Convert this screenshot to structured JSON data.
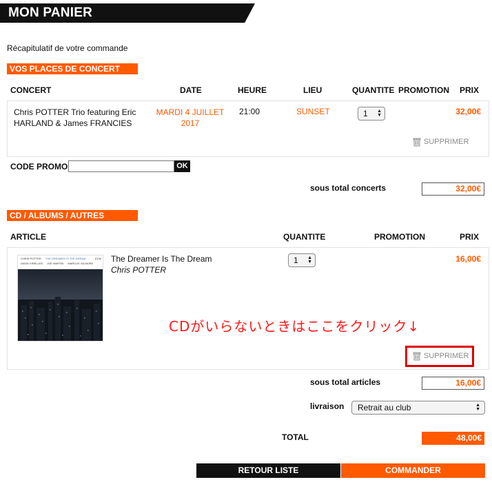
{
  "header": {
    "title": "MON PANIER"
  },
  "recap": "Récapitulatif de votre commande",
  "concerts": {
    "section_title": "VOS PLACES DE CONCERT",
    "columns": {
      "concert": "CONCERT",
      "date": "DATE",
      "heure": "HEURE",
      "lieu": "LIEU",
      "quantite": "QUANTITE",
      "promotion": "PROMOTION",
      "prix": "PRIX"
    },
    "item": {
      "title_line1": "Chris POTTER Trio featuring Eric",
      "title_line2": "HARLAND & James FRANCIES",
      "date_line1": "MARDI 4 JUILLET",
      "date_line2": "2017",
      "heure": "21:00",
      "lieu": "SUNSET",
      "quantite": "1",
      "prix": "32,00€",
      "delete_label": "SUPPRIMER"
    },
    "promo_label": "CODE PROMO",
    "promo_value": "",
    "promo_ok": "OK",
    "subtotal_label": "sous total concerts",
    "subtotal_value": "32,00€"
  },
  "articles": {
    "section_title": "CD / ALBUMS / AUTRES",
    "columns": {
      "article": "ARTICLE",
      "quantite": "QUANTITE",
      "promotion": "PROMOTION",
      "prix": "PRIX"
    },
    "item": {
      "title": "The Dreamer Is The Dream",
      "artist": "Chris POTTER",
      "quantite": "1",
      "prix": "16,00€",
      "delete_label": "SUPPRIMER",
      "cover": {
        "line1_left": "CHRIS POTTER",
        "line1_right": "THE DREAMER IS THE DREAM",
        "line1_far": "ECM",
        "line2": [
          "DAVID VIRELLES",
          "JOE MARTIN",
          "MARCUS GILMORE"
        ]
      }
    },
    "annotation": "CDがいらないときはここをクリック↓",
    "annotation_color": "#ff0000",
    "subtotal_label": "sous total articles",
    "subtotal_value": "16,00€",
    "livraison_label": "livraison",
    "livraison_value": "Retrait au club"
  },
  "total": {
    "label": "TOTAL",
    "value": "48,00€"
  },
  "buttons": {
    "retour": "RETOUR LISTE",
    "commander": "COMMANDER"
  },
  "colors": {
    "accent": "#ff5a00",
    "dark": "#111111"
  }
}
